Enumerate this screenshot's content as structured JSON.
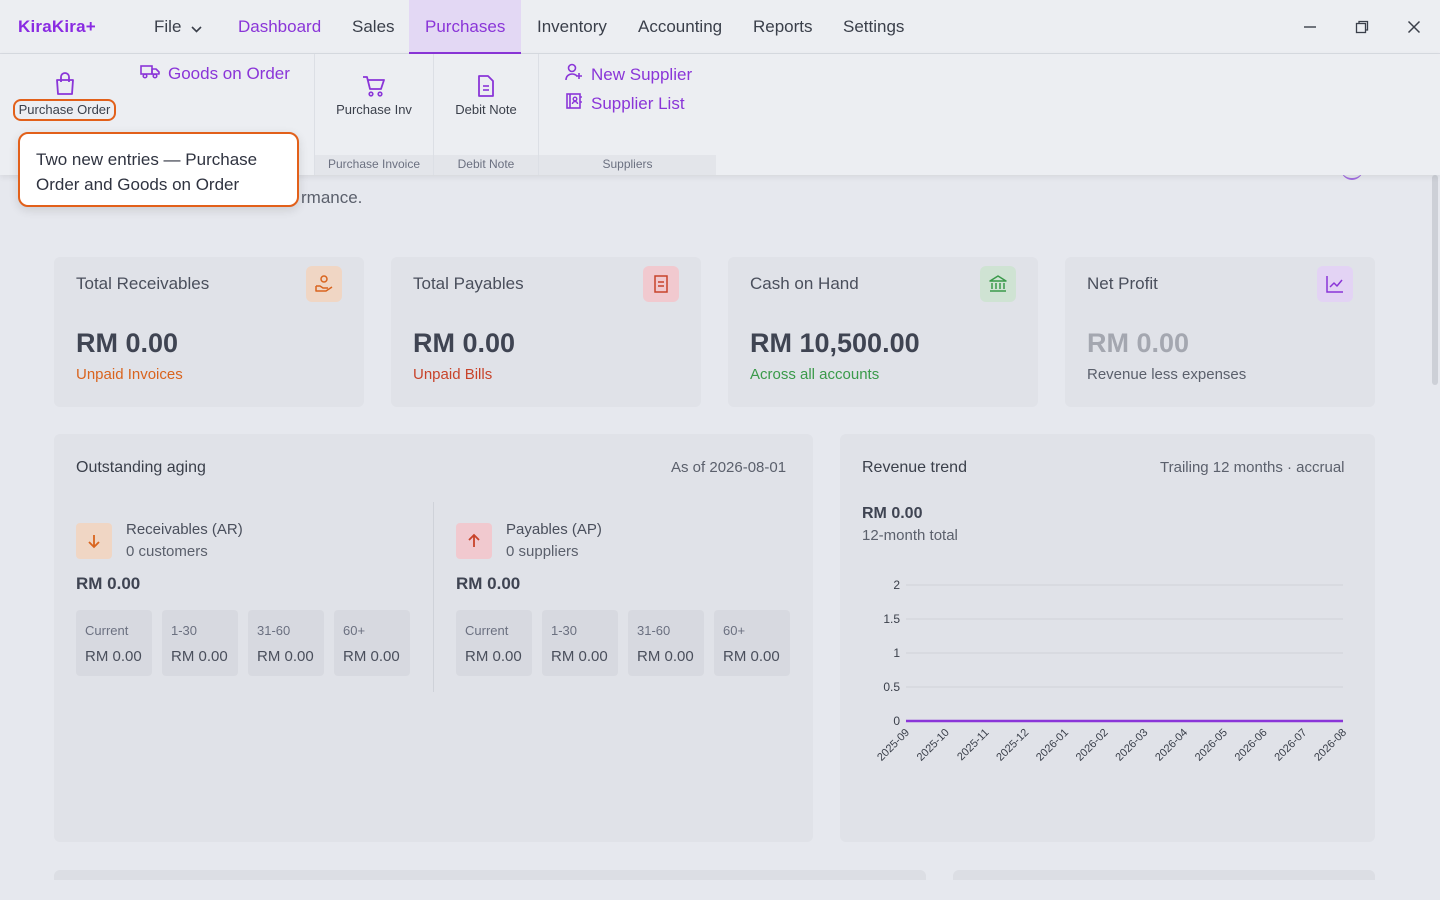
{
  "app": {
    "logo": "KiraKira+"
  },
  "menu": {
    "file": "File",
    "items": [
      "Dashboard",
      "Sales",
      "Purchases",
      "Inventory",
      "Accounting",
      "Reports",
      "Settings"
    ]
  },
  "ribbon": {
    "purchase_order": "Purchase Order",
    "goods_on_order": "Goods on Order",
    "purchase_inv": "Purchase Inv",
    "debit_note": "Debit Note",
    "new_supplier": "New Supplier",
    "supplier_list": "Supplier List",
    "captions": {
      "purchase_invoice": "Purchase Invoice",
      "debit_note": "Debit Note",
      "suppliers": "Suppliers"
    }
  },
  "tooltip": {
    "line1": "Two new entries — Purchase",
    "line2": "Order and Goods on Order"
  },
  "page": {
    "subtitle_visible": "rmance."
  },
  "cards": [
    {
      "label": "Total Receivables",
      "value": "RM 0.00",
      "note": "Unpaid Invoices",
      "note_color": "#d9641e",
      "badge_color": "#f0d6c4",
      "icon": "hand-coins-icon"
    },
    {
      "label": "Total Payables",
      "value": "RM 0.00",
      "note": "Unpaid Bills",
      "note_color": "#c8432a",
      "badge_color": "#f1c9cf",
      "icon": "document-icon"
    },
    {
      "label": "Cash on Hand",
      "value": "RM 10,500.00",
      "note": "Across all accounts",
      "note_color": "#3a9a4a",
      "badge_color": "#cfe3d3",
      "icon": "bank-icon"
    },
    {
      "label": "Net Profit",
      "value": "RM 0.00",
      "note": "Revenue less expenses",
      "note_color": "#5b606c",
      "badge_color": "#e3d3f4",
      "icon": "trend-icon"
    }
  ],
  "aging": {
    "title": "Outstanding aging",
    "as_of": "As of 2026-08-01",
    "ar": {
      "name": "Receivables (AR)",
      "sub": "0 customers",
      "total": "RM 0.00",
      "buckets": [
        {
          "label": "Current",
          "value": "RM 0.00"
        },
        {
          "label": "1-30",
          "value": "RM 0.00"
        },
        {
          "label": "31-60",
          "value": "RM 0.00"
        },
        {
          "label": "60+",
          "value": "RM 0.00"
        }
      ]
    },
    "ap": {
      "name": "Payables (AP)",
      "sub": "0 suppliers",
      "total": "RM 0.00",
      "buckets": [
        {
          "label": "Current",
          "value": "RM 0.00"
        },
        {
          "label": "1-30",
          "value": "RM 0.00"
        },
        {
          "label": "31-60",
          "value": "RM 0.00"
        },
        {
          "label": "60+",
          "value": "RM 0.00"
        }
      ]
    }
  },
  "revenue": {
    "title": "Revenue trend",
    "meta": "Trailing 12 months · accrual",
    "total": "RM 0.00",
    "total_label": "12-month total"
  },
  "chart_data": {
    "type": "line",
    "x": [
      "2025-09",
      "2025-10",
      "2025-11",
      "2025-12",
      "2026-01",
      "2026-02",
      "2026-03",
      "2026-04",
      "2026-05",
      "2026-06",
      "2026-07",
      "2026-08"
    ],
    "series": [
      {
        "values": [
          0,
          0,
          0,
          0,
          0,
          0,
          0,
          0,
          0,
          0,
          0,
          0
        ]
      }
    ],
    "yticks": [
      "0",
      "0.5",
      "1",
      "1.5",
      "2"
    ],
    "ylim": [
      0,
      2
    ],
    "grid": true,
    "line_color": "#8a35d8"
  }
}
